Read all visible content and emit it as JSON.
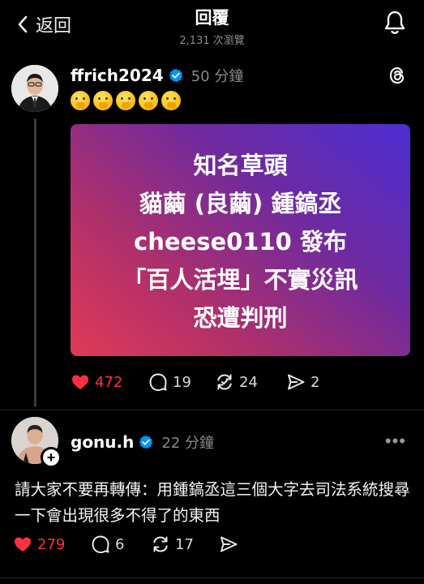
{
  "header": {
    "back_label": "返回",
    "title": "回覆",
    "views": "2,131 次瀏覽"
  },
  "post1": {
    "username": "ffrich2024",
    "time": "50 分鐘",
    "emoji_count": 5,
    "card_lines": [
      "知名草頭",
      "貓繭 (良繭) 鍾鎬丞",
      "cheese0110 發布",
      "「百人活埋」不實災訊",
      "恐遭判刑"
    ],
    "likes": "472",
    "replies": "19",
    "reposts": "24",
    "shares": "2"
  },
  "post2": {
    "username": "gonu.h",
    "time": "22 分鐘",
    "text": "請大家不要再轉傳：用鍾鎬丞這三個大字去司法系統搜尋一下會出現很多不得了的東西",
    "likes": "279",
    "replies": "6",
    "reposts": "17",
    "more_label": "•••"
  },
  "colors": {
    "like_red": "#ff3040",
    "verified_blue": "#0095f6",
    "card_gradient": [
      "#e03a56",
      "#6d2aa0",
      "#4c2ed2"
    ]
  },
  "icons": [
    "back-chevron-icon",
    "bell-icon",
    "verified-icon",
    "threads-logo-icon",
    "heart-icon",
    "comment-icon",
    "repost-icon",
    "share-icon",
    "more-icon",
    "plus-icon"
  ]
}
